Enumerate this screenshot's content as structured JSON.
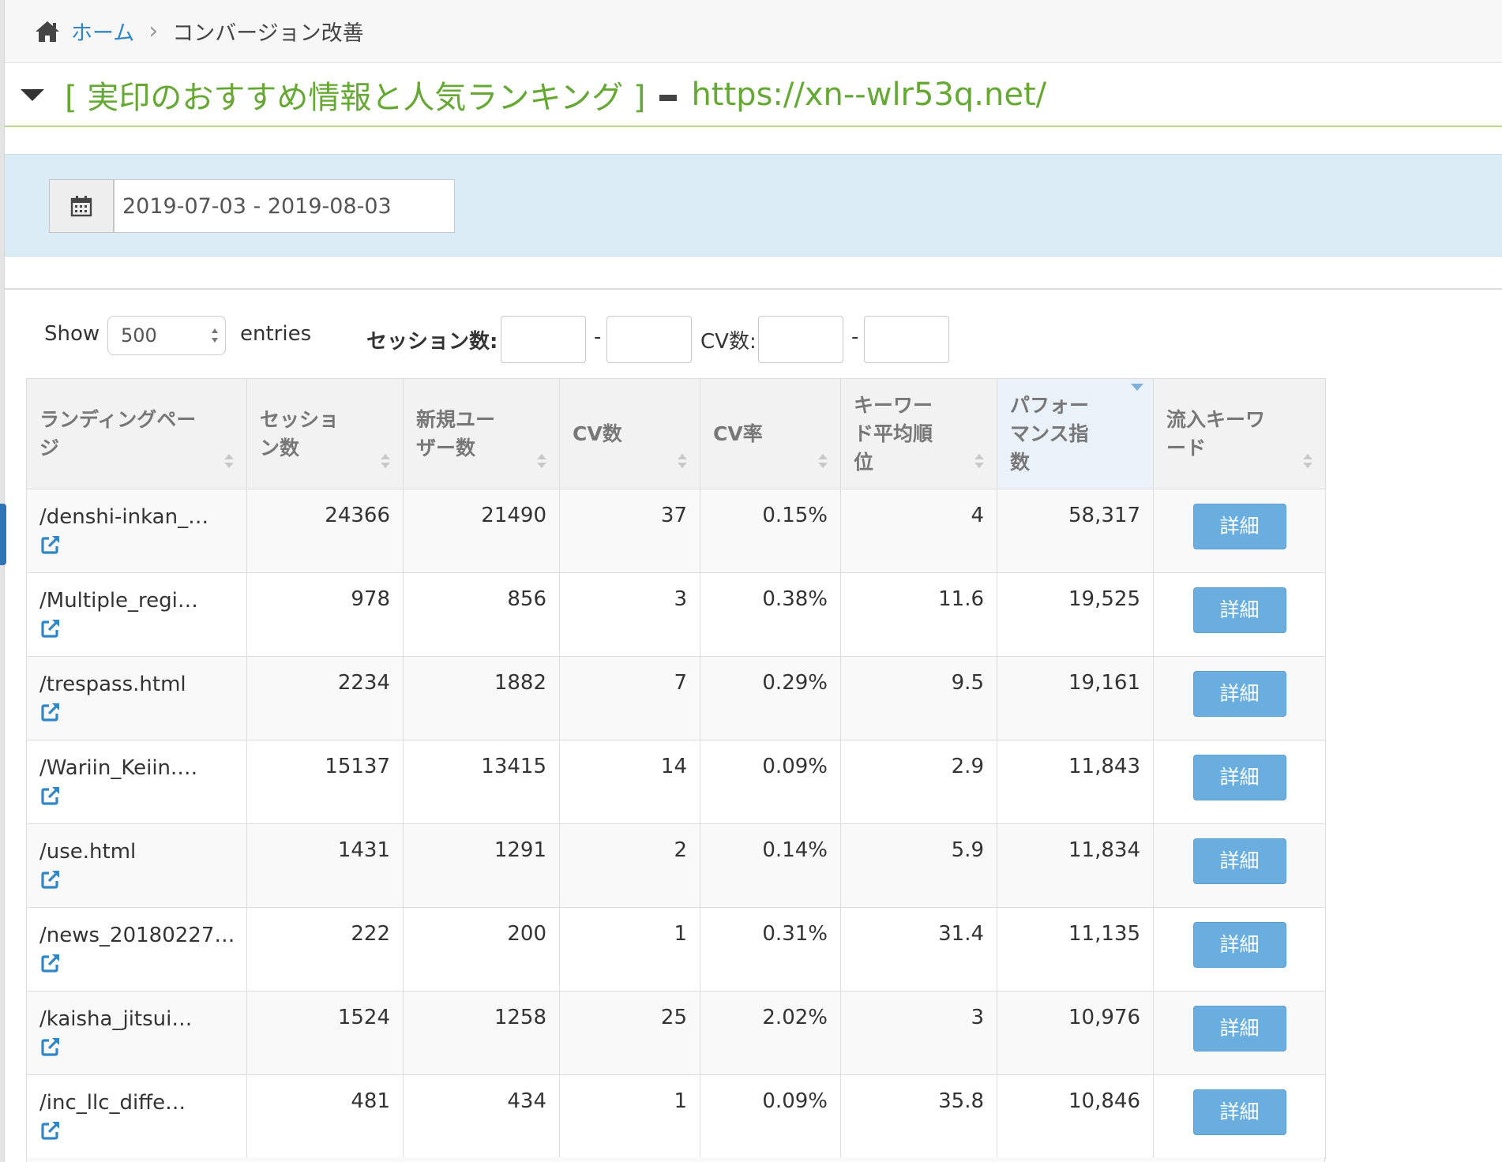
{
  "breadcrumb": {
    "home": "ホーム",
    "separator": "›",
    "current": "コンバージョン改善"
  },
  "title": {
    "site_name": "[ 実印のおすすめ情報と人気ランキング ]",
    "url": "https://xn--wlr53q.net/"
  },
  "date_filter": {
    "value": "2019-07-03 - 2019-08-03",
    "icon": "calendar-icon"
  },
  "controls": {
    "show_label": "Show",
    "entries_value": "500",
    "entries_label": "entries",
    "session_label": "セッション数:",
    "range_sep": "-",
    "cv_label": "CV数:"
  },
  "table": {
    "headers": [
      {
        "key": "landing",
        "label": "ランディングページ"
      },
      {
        "key": "sessions",
        "label": "セッション数"
      },
      {
        "key": "new_users",
        "label": "新規ユーザー数"
      },
      {
        "key": "cv",
        "label": "CV数"
      },
      {
        "key": "cv_rate",
        "label": "CV率"
      },
      {
        "key": "rank",
        "label": "キーワード平均順位"
      },
      {
        "key": "perf",
        "label": "パフォーマンス指数"
      },
      {
        "key": "keywords",
        "label": "流入キーワード"
      }
    ],
    "detail_label": "詳細",
    "rows": [
      {
        "page": "/denshi-inkan_…",
        "sessions": "24366",
        "new_users": "21490",
        "cv": "37",
        "cv_rate": "0.15%",
        "rank": "4",
        "perf": "58,317"
      },
      {
        "page": "/Multiple_regi…",
        "sessions": "978",
        "new_users": "856",
        "cv": "3",
        "cv_rate": "0.38%",
        "rank": "11.6",
        "perf": "19,525"
      },
      {
        "page": "/trespass.html",
        "sessions": "2234",
        "new_users": "1882",
        "cv": "7",
        "cv_rate": "0.29%",
        "rank": "9.5",
        "perf": "19,161"
      },
      {
        "page": "/Wariin_Keiin.…",
        "sessions": "15137",
        "new_users": "13415",
        "cv": "14",
        "cv_rate": "0.09%",
        "rank": "2.9",
        "perf": "11,843"
      },
      {
        "page": "/use.html",
        "sessions": "1431",
        "new_users": "1291",
        "cv": "2",
        "cv_rate": "0.14%",
        "rank": "5.9",
        "perf": "11,834"
      },
      {
        "page": "/news_20180227…",
        "sessions": "222",
        "new_users": "200",
        "cv": "1",
        "cv_rate": "0.31%",
        "rank": "31.4",
        "perf": "11,135"
      },
      {
        "page": "/kaisha_jitsui…",
        "sessions": "1524",
        "new_users": "1258",
        "cv": "25",
        "cv_rate": "2.02%",
        "rank": "3",
        "perf": "10,976"
      },
      {
        "page": "/inc_llc_diffe…",
        "sessions": "481",
        "new_users": "434",
        "cv": "1",
        "cv_rate": "0.09%",
        "rank": "35.8",
        "perf": "10,846"
      }
    ]
  },
  "colors": {
    "accent_green": "#66a834",
    "link_blue": "#2f86c8",
    "button_blue": "#6aaee0",
    "filter_bg": "#dbecf6"
  }
}
